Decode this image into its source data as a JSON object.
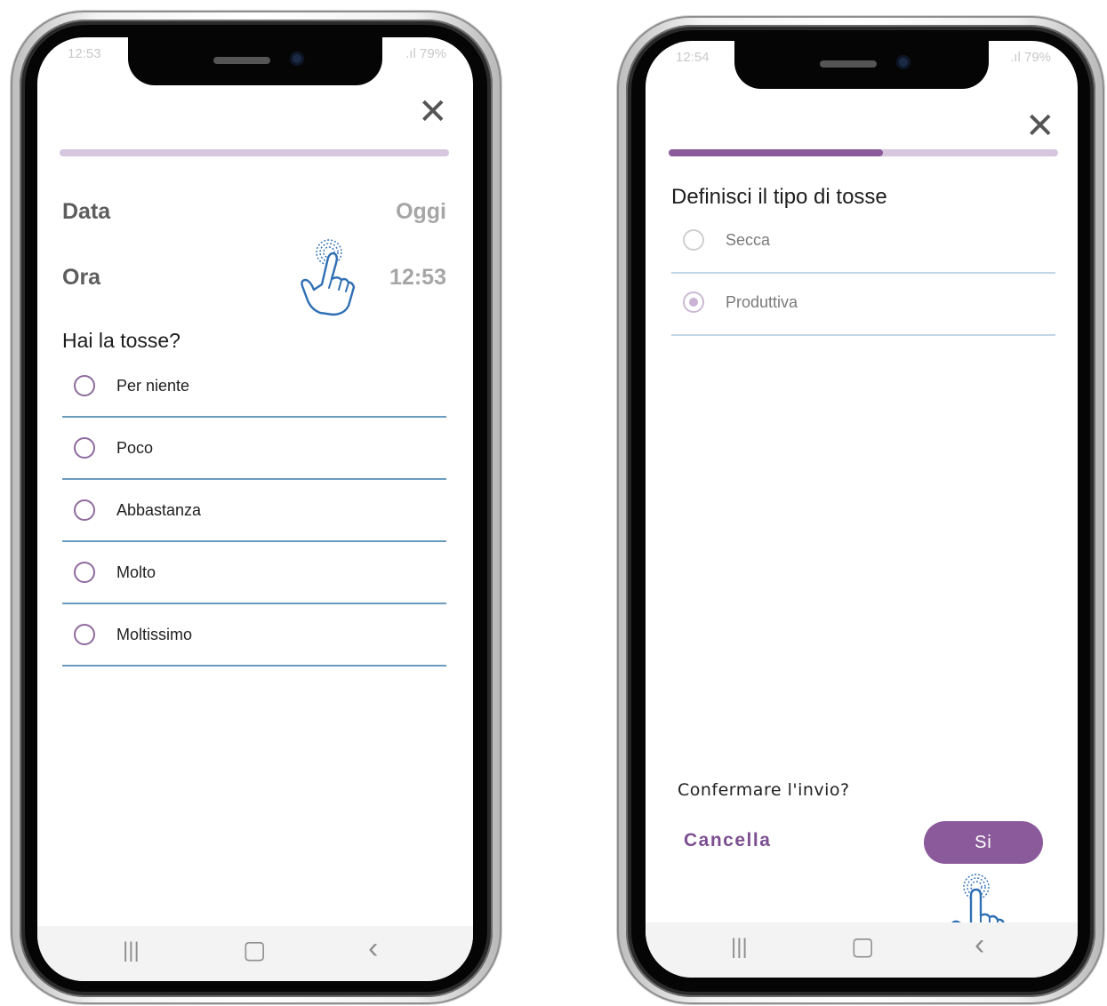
{
  "screen1": {
    "status": {
      "time": "12:53",
      "battery": ".ıl 79%"
    },
    "close_icon": "close-icon",
    "progress": 0,
    "date_label": "Data",
    "date_value": "Oggi",
    "time_label": "Ora",
    "time_value": "12:53",
    "question": "Hai la tosse?",
    "options": [
      "Per niente",
      "Poco",
      "Abbastanza",
      "Molto",
      "Moltissimo"
    ]
  },
  "screen2": {
    "status": {
      "time": "12:54",
      "battery": ".ıl 79%"
    },
    "close_icon": "close-icon",
    "progress": 0.55,
    "question": "Definisci il tipo di tosse",
    "options": [
      "Secca",
      "Produttiva"
    ],
    "selected_option": "Produttiva",
    "confirm_text": "Confermare l'invio?",
    "cancel_label": "Cancella",
    "yes_label": "Si"
  },
  "nav": {
    "recent": "|||",
    "home": "▢",
    "back": "‹"
  },
  "colors": {
    "accent": "#8b5a9b",
    "divider": "#6a9bbf",
    "progress_track": "#d6c6de"
  }
}
